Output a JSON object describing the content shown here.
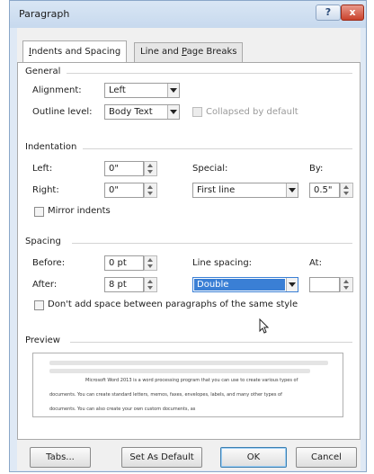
{
  "window": {
    "title": "Paragraph",
    "help_label": "?",
    "close_label": "x"
  },
  "tabs": [
    {
      "label": "Indents and Spacing",
      "accel": "I",
      "rest": "ndents and Spacing",
      "active": true
    },
    {
      "label": "Line and Page Breaks",
      "pre": "Line and ",
      "accel": "P",
      "rest": "age Breaks",
      "active": false
    }
  ],
  "general": {
    "heading": "General",
    "alignment_label": "Alignment:",
    "alignment_value": "Left",
    "outline_level_label": "Outline level:",
    "outline_level_value": "Body Text",
    "collapsed_label": "Collapsed by default"
  },
  "indentation": {
    "heading": "Indentation",
    "left_label": "Left:",
    "left_value": "0\"",
    "right_label": "Right:",
    "right_value": "0\"",
    "special_label": "Special:",
    "special_value": "First line",
    "by_label": "By:",
    "by_value": "0.5\"",
    "mirror_label": "Mirror indents"
  },
  "spacing": {
    "heading": "Spacing",
    "before_label": "Before:",
    "before_value": "0 pt",
    "after_label": "After:",
    "after_value": "8 pt",
    "line_spacing_label": "Line spacing:",
    "line_spacing_value": "Double",
    "at_label": "At:",
    "at_value": "",
    "dont_add_label": "Don't add space between paragraphs of the same style"
  },
  "preview": {
    "heading": "Preview",
    "sample_lines": [
      "Microsoft Word 2013 is a word processing program that you can use to create various types of",
      "documents. You can create standard letters, memos, faxes, envelopes, labels, and many other types of",
      "documents. You can also create your own custom documents, as"
    ]
  },
  "buttons": {
    "tabs_label": "Tabs...",
    "set_default_label": "Set As Default",
    "ok_label": "OK",
    "cancel_label": "Cancel"
  },
  "colors": {
    "selection": "#3a7fd5",
    "title_bar": "#c7d9ee",
    "close_button": "#c9422c"
  }
}
